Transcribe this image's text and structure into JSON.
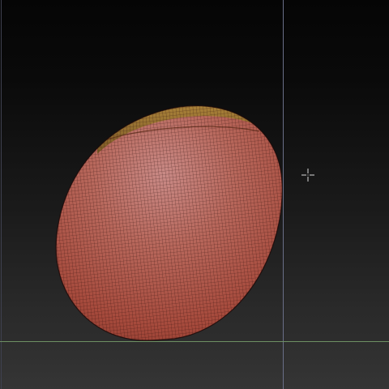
{
  "app": {
    "view": "3d-sculpt-viewport"
  },
  "colors": {
    "background_top": "#050505",
    "background_bottom": "#333333",
    "mesh_base": "#a64a3c",
    "mesh_highlight": "#c98a86",
    "mesh_shadow": "#4a1a14",
    "polypaint_cap": "#8a6a2c",
    "wireframe": "#2a0d09",
    "guide_vertical": "#6a6f88",
    "horizon_line": "#6d8f62",
    "cursor": "#d8d8d8"
  },
  "icons": {
    "cursor": "crosshair-cursor-icon"
  }
}
